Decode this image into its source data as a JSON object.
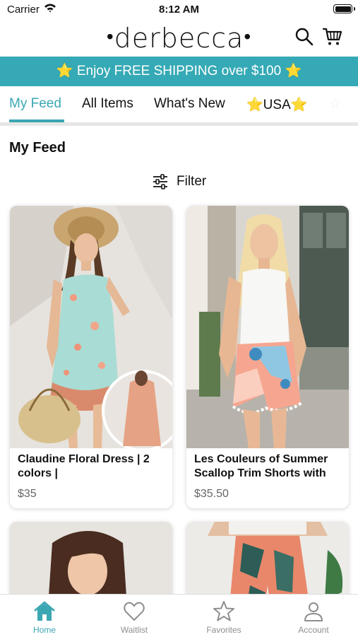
{
  "status_bar": {
    "carrier": "Carrier",
    "time": "8:12 AM"
  },
  "header": {
    "logo": "derbecca",
    "logo_dot": "•",
    "icons": [
      "search-icon",
      "cart-icon"
    ]
  },
  "banner": {
    "star": "⭐",
    "text": "Enjoy FREE SHIPPING over $100"
  },
  "tabs": [
    {
      "label": "My Feed",
      "active": true
    },
    {
      "label": "All Items"
    },
    {
      "label": "What's New"
    },
    {
      "label": "USA",
      "star": "⭐"
    }
  ],
  "section_title": "My Feed",
  "filter": {
    "label": "Filter",
    "icon": "sliders-icon"
  },
  "products": [
    {
      "name": "Claudine Floral Dress | 2 colors |",
      "price": "$35"
    },
    {
      "name": "Les Couleurs of Summer Scallop Trim Shorts with",
      "price": "$35.50"
    }
  ],
  "bottom_nav": [
    {
      "label": "Home",
      "icon": "home-icon",
      "active": true
    },
    {
      "label": "Waitlist",
      "icon": "heart-icon"
    },
    {
      "label": "Favorites",
      "icon": "star-icon"
    },
    {
      "label": "Account",
      "icon": "person-icon"
    }
  ],
  "colors": {
    "accent": "#3aa7b3",
    "banner": "#35a9b5",
    "star": "#ffd23f"
  }
}
